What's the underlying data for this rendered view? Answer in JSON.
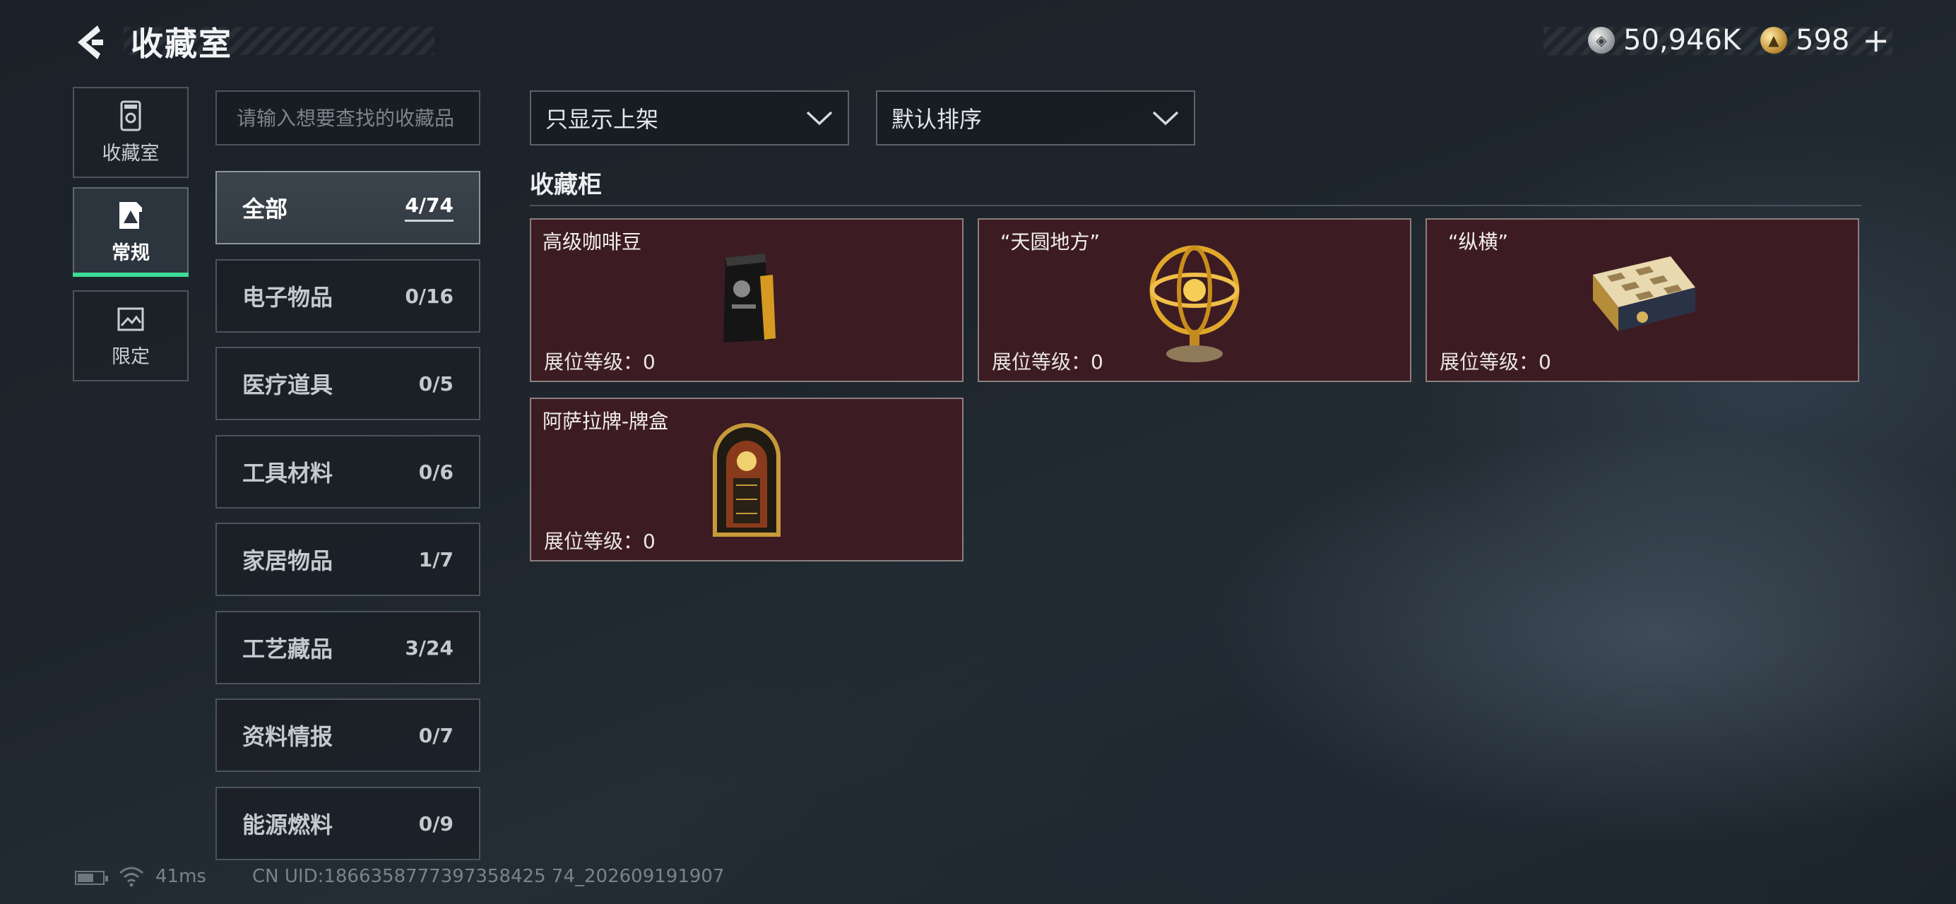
{
  "header": {
    "title": "收藏室",
    "silver_amount": "50,946K",
    "gold_amount": "598",
    "plus_symbol": "+"
  },
  "nav": [
    {
      "label": "收藏室",
      "icon": "storage-cabinet-icon",
      "active": false
    },
    {
      "label": "常规",
      "icon": "document-icon",
      "active": true
    },
    {
      "label": "限定",
      "icon": "image-frame-icon",
      "active": false
    }
  ],
  "search": {
    "placeholder": "请输入想要查找的收藏品",
    "value": ""
  },
  "categories": [
    {
      "name": "全部",
      "count": "4/74",
      "active": true
    },
    {
      "name": "电子物品",
      "count": "0/16"
    },
    {
      "name": "医疗道具",
      "count": "0/5"
    },
    {
      "name": "工具材料",
      "count": "0/6"
    },
    {
      "name": "家居物品",
      "count": "1/7"
    },
    {
      "name": "工艺藏品",
      "count": "3/24"
    },
    {
      "name": "资料情报",
      "count": "0/7"
    },
    {
      "name": "能源燃料",
      "count": "0/9"
    }
  ],
  "filters": {
    "filter_value": "只显示上架",
    "sort_value": "默认排序"
  },
  "section": {
    "title": "收藏柜"
  },
  "items": [
    {
      "name": "高级咖啡豆",
      "level": "展位等级：0",
      "icon": "coffee-bag-icon"
    },
    {
      "name": "“天圆地方”",
      "level": "展位等级：0",
      "icon": "armillary-sphere-icon"
    },
    {
      "name": "“纵横”",
      "level": "展位等级：0",
      "icon": "chess-board-icon"
    },
    {
      "name": "阿萨拉牌-牌盒",
      "level": "展位等级：0",
      "icon": "card-box-icon"
    }
  ],
  "footer": {
    "ping": "41ms",
    "uid": "CN UID:1866358777397358425 74_202609191907"
  },
  "colors": {
    "accent": "#3ddc97",
    "card_bg": "#3c1c22",
    "panel_border": "#4b545c"
  }
}
